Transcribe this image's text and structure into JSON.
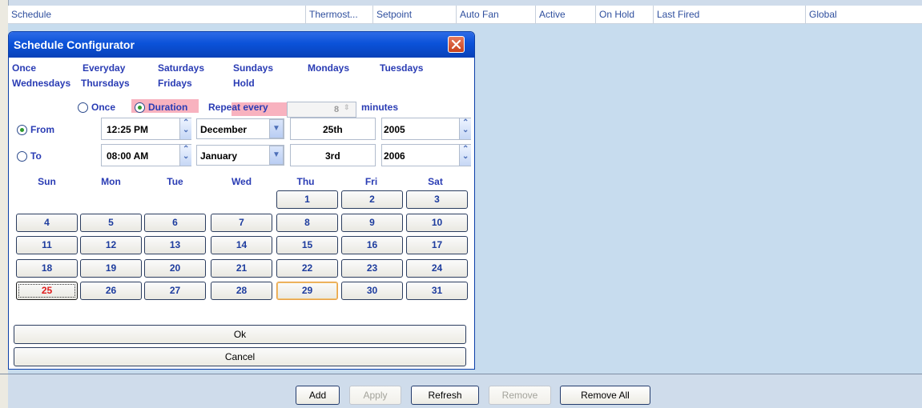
{
  "columns": {
    "schedule": "Schedule",
    "thermost": "Thermost...",
    "setpoint": "Setpoint",
    "auto_fan": "Auto Fan",
    "active": "Active",
    "on_hold": "On Hold",
    "last_fired": "Last Fired",
    "global": "Global"
  },
  "dialog": {
    "title": "Schedule Configurator",
    "presets": [
      "Once",
      "Everyday",
      "Saturdays",
      "Sundays",
      "Mondays",
      "Tuesdays",
      "Wednesdays",
      "Thursdays",
      "Fridays",
      "Hold"
    ],
    "mode_once": "Once",
    "mode_duration": "Duration",
    "repeat_label": "Repeat every",
    "repeat_value": "8",
    "minutes_label": "minutes",
    "from_label": "From",
    "to_label": "To",
    "from": {
      "time": "12:25 PM",
      "month": "December",
      "day": "25th",
      "year": "2005"
    },
    "to": {
      "time": "08:00 AM",
      "month": "January",
      "day": "3rd",
      "year": "2006"
    },
    "weekdays": [
      "Sun",
      "Mon",
      "Tue",
      "Wed",
      "Thu",
      "Fri",
      "Sat"
    ],
    "days": [
      "1",
      "2",
      "3",
      "4",
      "5",
      "6",
      "7",
      "8",
      "9",
      "10",
      "11",
      "12",
      "13",
      "14",
      "15",
      "16",
      "17",
      "18",
      "19",
      "20",
      "21",
      "22",
      "23",
      "24",
      "25",
      "26",
      "27",
      "28",
      "29",
      "30",
      "31"
    ],
    "today": "25",
    "selected": "29",
    "ok": "Ok",
    "cancel": "Cancel"
  },
  "toolbar": {
    "add": "Add",
    "apply": "Apply",
    "refresh": "Refresh",
    "remove": "Remove",
    "remove_all": "Remove All"
  },
  "colors": {
    "title_bar": "#0b52d9",
    "text_blue": "#2a3cb4",
    "highlight_pink": "#f8b2bf",
    "today_red": "#e01b1b",
    "background": "#cfdceb"
  }
}
